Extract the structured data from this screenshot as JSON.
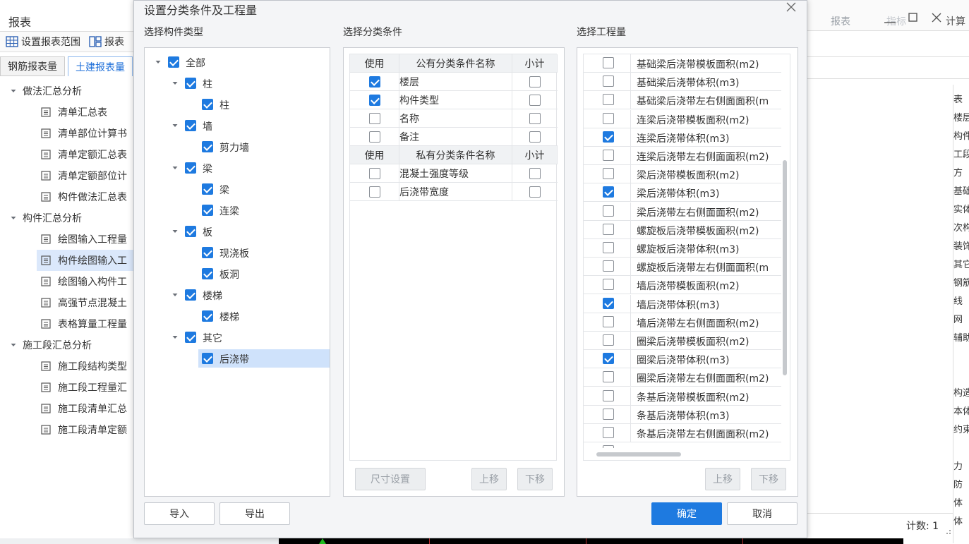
{
  "background": {
    "title": "报表",
    "toolbar": {
      "set_range": "设置报表范围",
      "report": "报表"
    },
    "tabs": [
      "钢筋报表量",
      "土建报表量"
    ],
    "tree": [
      {
        "label": "做法汇总分析",
        "group": true
      },
      {
        "label": "清单汇总表",
        "group": false
      },
      {
        "label": "清单部位计算书",
        "group": false
      },
      {
        "label": "清单定额汇总表",
        "group": false
      },
      {
        "label": "清单定额部位计",
        "group": false
      },
      {
        "label": "构件做法汇总表",
        "group": false
      },
      {
        "label": "构件汇总分析",
        "group": true
      },
      {
        "label": "绘图输入工程量",
        "group": false
      },
      {
        "label": "构件绘图输入工",
        "group": false,
        "selected": true
      },
      {
        "label": "绘图输入构件工",
        "group": false
      },
      {
        "label": "高强节点混凝土",
        "group": false
      },
      {
        "label": "表格算量工程量",
        "group": false
      },
      {
        "label": "施工段汇总分析",
        "group": true
      },
      {
        "label": "施工段结构类型",
        "group": false
      },
      {
        "label": "施工段工程量汇",
        "group": false
      },
      {
        "label": "施工段清单汇总",
        "group": false
      },
      {
        "label": "施工段清单定额",
        "group": false
      }
    ],
    "right_header": {
      "report": "报表",
      "ghost1": "指标",
      "ghost2": "计算"
    },
    "right_strip": [
      "表",
      "楼层",
      "构件",
      "工段",
      "方",
      "基础",
      "实体",
      "次构",
      "装饰",
      "其它",
      "钢筋",
      "线",
      "网",
      "辅助",
      "",
      "",
      "构造",
      "本体",
      "约束",
      "",
      "力",
      "防",
      "体",
      "体"
    ],
    "count_label": "计数: 1"
  },
  "dialog": {
    "title": "设置分类条件及工程量",
    "close_glyph": "×",
    "left": {
      "section_title": "选择构件类型",
      "tree": [
        {
          "label": "全部",
          "level": 0,
          "caret": true,
          "checked": true
        },
        {
          "label": "柱",
          "level": 1,
          "caret": true,
          "checked": true
        },
        {
          "label": "柱",
          "level": 2,
          "caret": false,
          "checked": true
        },
        {
          "label": "墙",
          "level": 1,
          "caret": true,
          "checked": true
        },
        {
          "label": "剪力墙",
          "level": 2,
          "caret": false,
          "checked": true
        },
        {
          "label": "梁",
          "level": 1,
          "caret": true,
          "checked": true
        },
        {
          "label": "梁",
          "level": 2,
          "caret": false,
          "checked": true
        },
        {
          "label": "连梁",
          "level": 2,
          "caret": false,
          "checked": true
        },
        {
          "label": "板",
          "level": 1,
          "caret": true,
          "checked": true
        },
        {
          "label": "现浇板",
          "level": 2,
          "caret": false,
          "checked": true
        },
        {
          "label": "板洞",
          "level": 2,
          "caret": false,
          "checked": true
        },
        {
          "label": "楼梯",
          "level": 1,
          "caret": true,
          "checked": true
        },
        {
          "label": "楼梯",
          "level": 2,
          "caret": false,
          "checked": true
        },
        {
          "label": "其它",
          "level": 1,
          "caret": true,
          "checked": true
        },
        {
          "label": "后浇带",
          "level": 2,
          "caret": false,
          "checked": true,
          "selected": true
        }
      ],
      "import_label": "导入",
      "export_label": "导出"
    },
    "middle": {
      "section_title": "选择分类条件",
      "public_header": {
        "use": "使用",
        "name": "公有分类条件名称",
        "subtotal": "小计"
      },
      "public_rows": [
        {
          "name": "楼层",
          "use": true,
          "subtotal": false
        },
        {
          "name": "构件类型",
          "use": true,
          "subtotal": false
        },
        {
          "name": "名称",
          "use": false,
          "subtotal": false
        },
        {
          "name": "备注",
          "use": false,
          "subtotal": false
        }
      ],
      "private_header": {
        "use": "使用",
        "name": "私有分类条件名称",
        "subtotal": "小计"
      },
      "private_rows": [
        {
          "name": "混凝土强度等级",
          "use": false,
          "subtotal": false
        },
        {
          "name": "后浇带宽度",
          "use": false,
          "subtotal": false
        }
      ],
      "size_setting_label": "尺寸设置",
      "move_up_label": "上移",
      "move_down_label": "下移"
    },
    "right": {
      "section_title": "选择工程量",
      "items": [
        {
          "name": "基础梁后浇带模板面积(m2)",
          "checked": false
        },
        {
          "name": "基础梁后浇带体积(m3)",
          "checked": false
        },
        {
          "name": "基础梁后浇带左右侧面面积(m",
          "checked": false
        },
        {
          "name": "连梁后浇带模板面积(m2)",
          "checked": false
        },
        {
          "name": "连梁后浇带体积(m3)",
          "checked": true
        },
        {
          "name": "连梁后浇带左右侧面面积(m2)",
          "checked": false
        },
        {
          "name": "梁后浇带模板面积(m2)",
          "checked": false
        },
        {
          "name": "梁后浇带体积(m3)",
          "checked": true
        },
        {
          "name": "梁后浇带左右侧面面积(m2)",
          "checked": false
        },
        {
          "name": "螺旋板后浇带模板面积(m2)",
          "checked": false
        },
        {
          "name": "螺旋板后浇带体积(m3)",
          "checked": false
        },
        {
          "name": "螺旋板后浇带左右侧面面积(m",
          "checked": false
        },
        {
          "name": "墙后浇带模板面积(m2)",
          "checked": false
        },
        {
          "name": "墙后浇带体积(m3)",
          "checked": true
        },
        {
          "name": "墙后浇带左右侧面面积(m2)",
          "checked": false
        },
        {
          "name": "圈梁后浇带模板面积(m2)",
          "checked": false
        },
        {
          "name": "圈梁后浇带体积(m3)",
          "checked": true
        },
        {
          "name": "圈梁后浇带左右侧面面积(m2)",
          "checked": false
        },
        {
          "name": "条基后浇带模板面积(m2)",
          "checked": false
        },
        {
          "name": "条基后浇带体积(m3)",
          "checked": false
        },
        {
          "name": "条基后浇带左右侧面面积(m2)",
          "checked": false
        }
      ],
      "move_up_label": "上移",
      "move_down_label": "下移"
    },
    "ok_label": "确定",
    "cancel_label": "取消"
  }
}
